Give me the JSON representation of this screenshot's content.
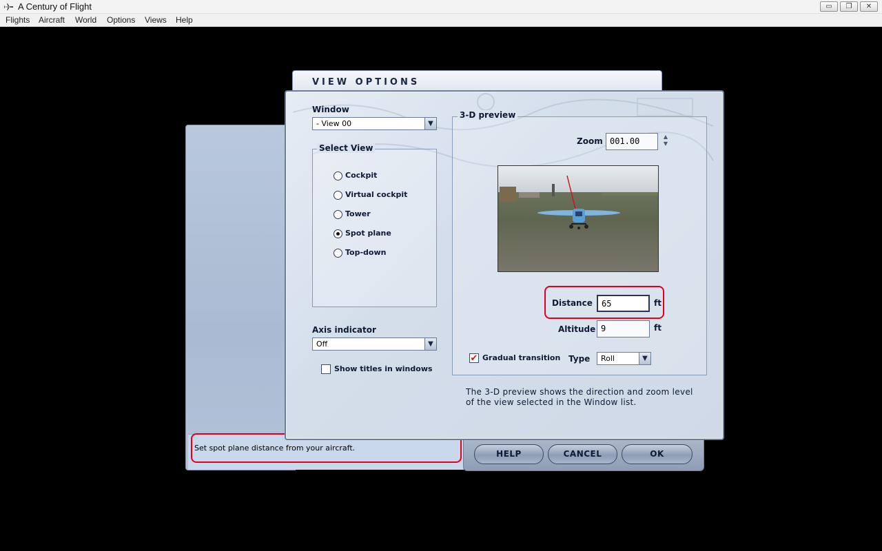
{
  "window": {
    "title": "A Century of Flight",
    "minimize": "▭",
    "restore": "❐",
    "close": "✕"
  },
  "menu": [
    "Flights",
    "Aircraft",
    "World",
    "Options",
    "Views",
    "Help"
  ],
  "dialog": {
    "title": "VIEW OPTIONS",
    "window_label": "Window",
    "window_value": "- View 00",
    "select_view_label": "Select View",
    "views": [
      "Cockpit",
      "Virtual cockpit",
      "Tower",
      "Spot plane",
      "Top-down"
    ],
    "selected_view": "Spot plane",
    "axis_indicator_label": "Axis indicator",
    "axis_indicator_value": "Off",
    "show_titles_label": "Show titles in windows",
    "show_titles_checked": false,
    "preview_label": "3-D preview",
    "zoom_label": "Zoom",
    "zoom_value": "001.00",
    "distance_label": "Distance",
    "distance_value": "65",
    "distance_unit": "ft",
    "altitude_label": "Altitude",
    "altitude_value": "9",
    "altitude_unit": "ft",
    "gradual_transition_label": "Gradual transition",
    "gradual_transition_checked": true,
    "type_label": "Type",
    "type_value": "Roll",
    "description": "The 3-D preview shows the direction and zoom level of the view selected in the Window list.",
    "status": "Set spot plane distance from your aircraft.",
    "buttons": {
      "help": "HELP",
      "cancel": "CANCEL",
      "ok": "OK"
    }
  },
  "colors": {
    "highlight": "#e0001b",
    "panel": "#d4deeb",
    "accent": "#1b2640"
  },
  "icons": {
    "arrow": "▼",
    "check": "✔",
    "spin_up": "▲",
    "spin_down": "▼"
  }
}
